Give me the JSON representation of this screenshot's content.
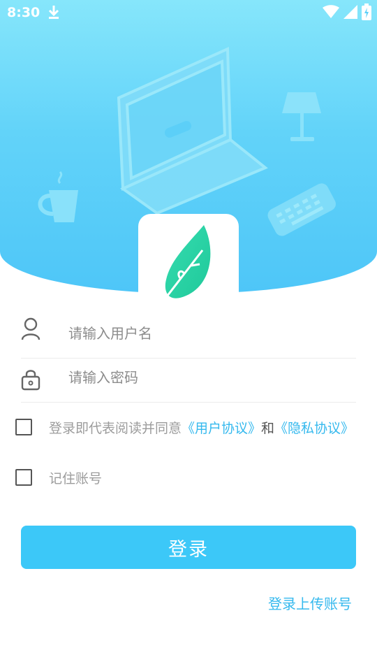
{
  "status": {
    "time": "8:30"
  },
  "login": {
    "username_placeholder": "请输入用户名",
    "password_placeholder": "请输入密码",
    "agreement_prefix": "登录即代表阅读并同意",
    "user_agreement": "《用户协议》",
    "conjunction": "和",
    "privacy_policy": "《隐私协议》",
    "remember_label": "记住账号",
    "login_button": "登录",
    "upload_link": "登录上传账号"
  },
  "colors": {
    "accent": "#3cc8f8",
    "link": "#35b9ee",
    "hero_top": "#86e6fb",
    "hero_bottom": "#4ec6f8",
    "logo_leaf": "#2fd7a6"
  }
}
